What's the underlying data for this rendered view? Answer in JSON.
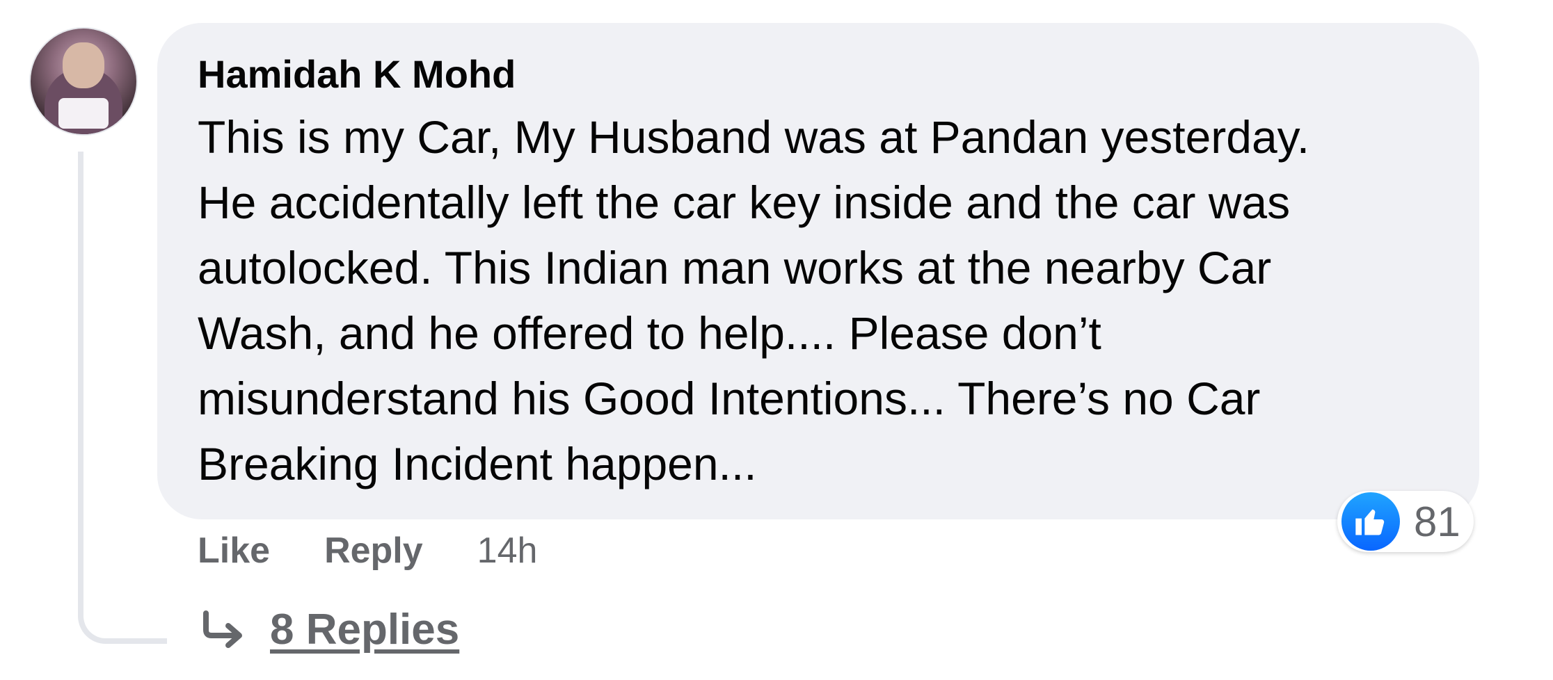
{
  "comment": {
    "author": "Hamidah K Mohd",
    "text_lines": [
      "This is my Car, My Husband was at Pandan yesterday.",
      "He accidentally left the car key inside and the car was",
      "autolocked. This Indian man works at the nearby Car",
      "Wash, and he offered to help.... Please don’t",
      "misunderstand his Good Intentions... There’s no Car",
      "Breaking Incident happen..."
    ],
    "reaction": {
      "icon": "thumbs-up-icon",
      "count": "81",
      "color": "#0966ff"
    },
    "actions": {
      "like_label": "Like",
      "reply_label": "Reply",
      "timestamp": "14h"
    },
    "replies": {
      "arrow_icon": "reply-arrow-icon",
      "label": "8 Replies"
    }
  }
}
